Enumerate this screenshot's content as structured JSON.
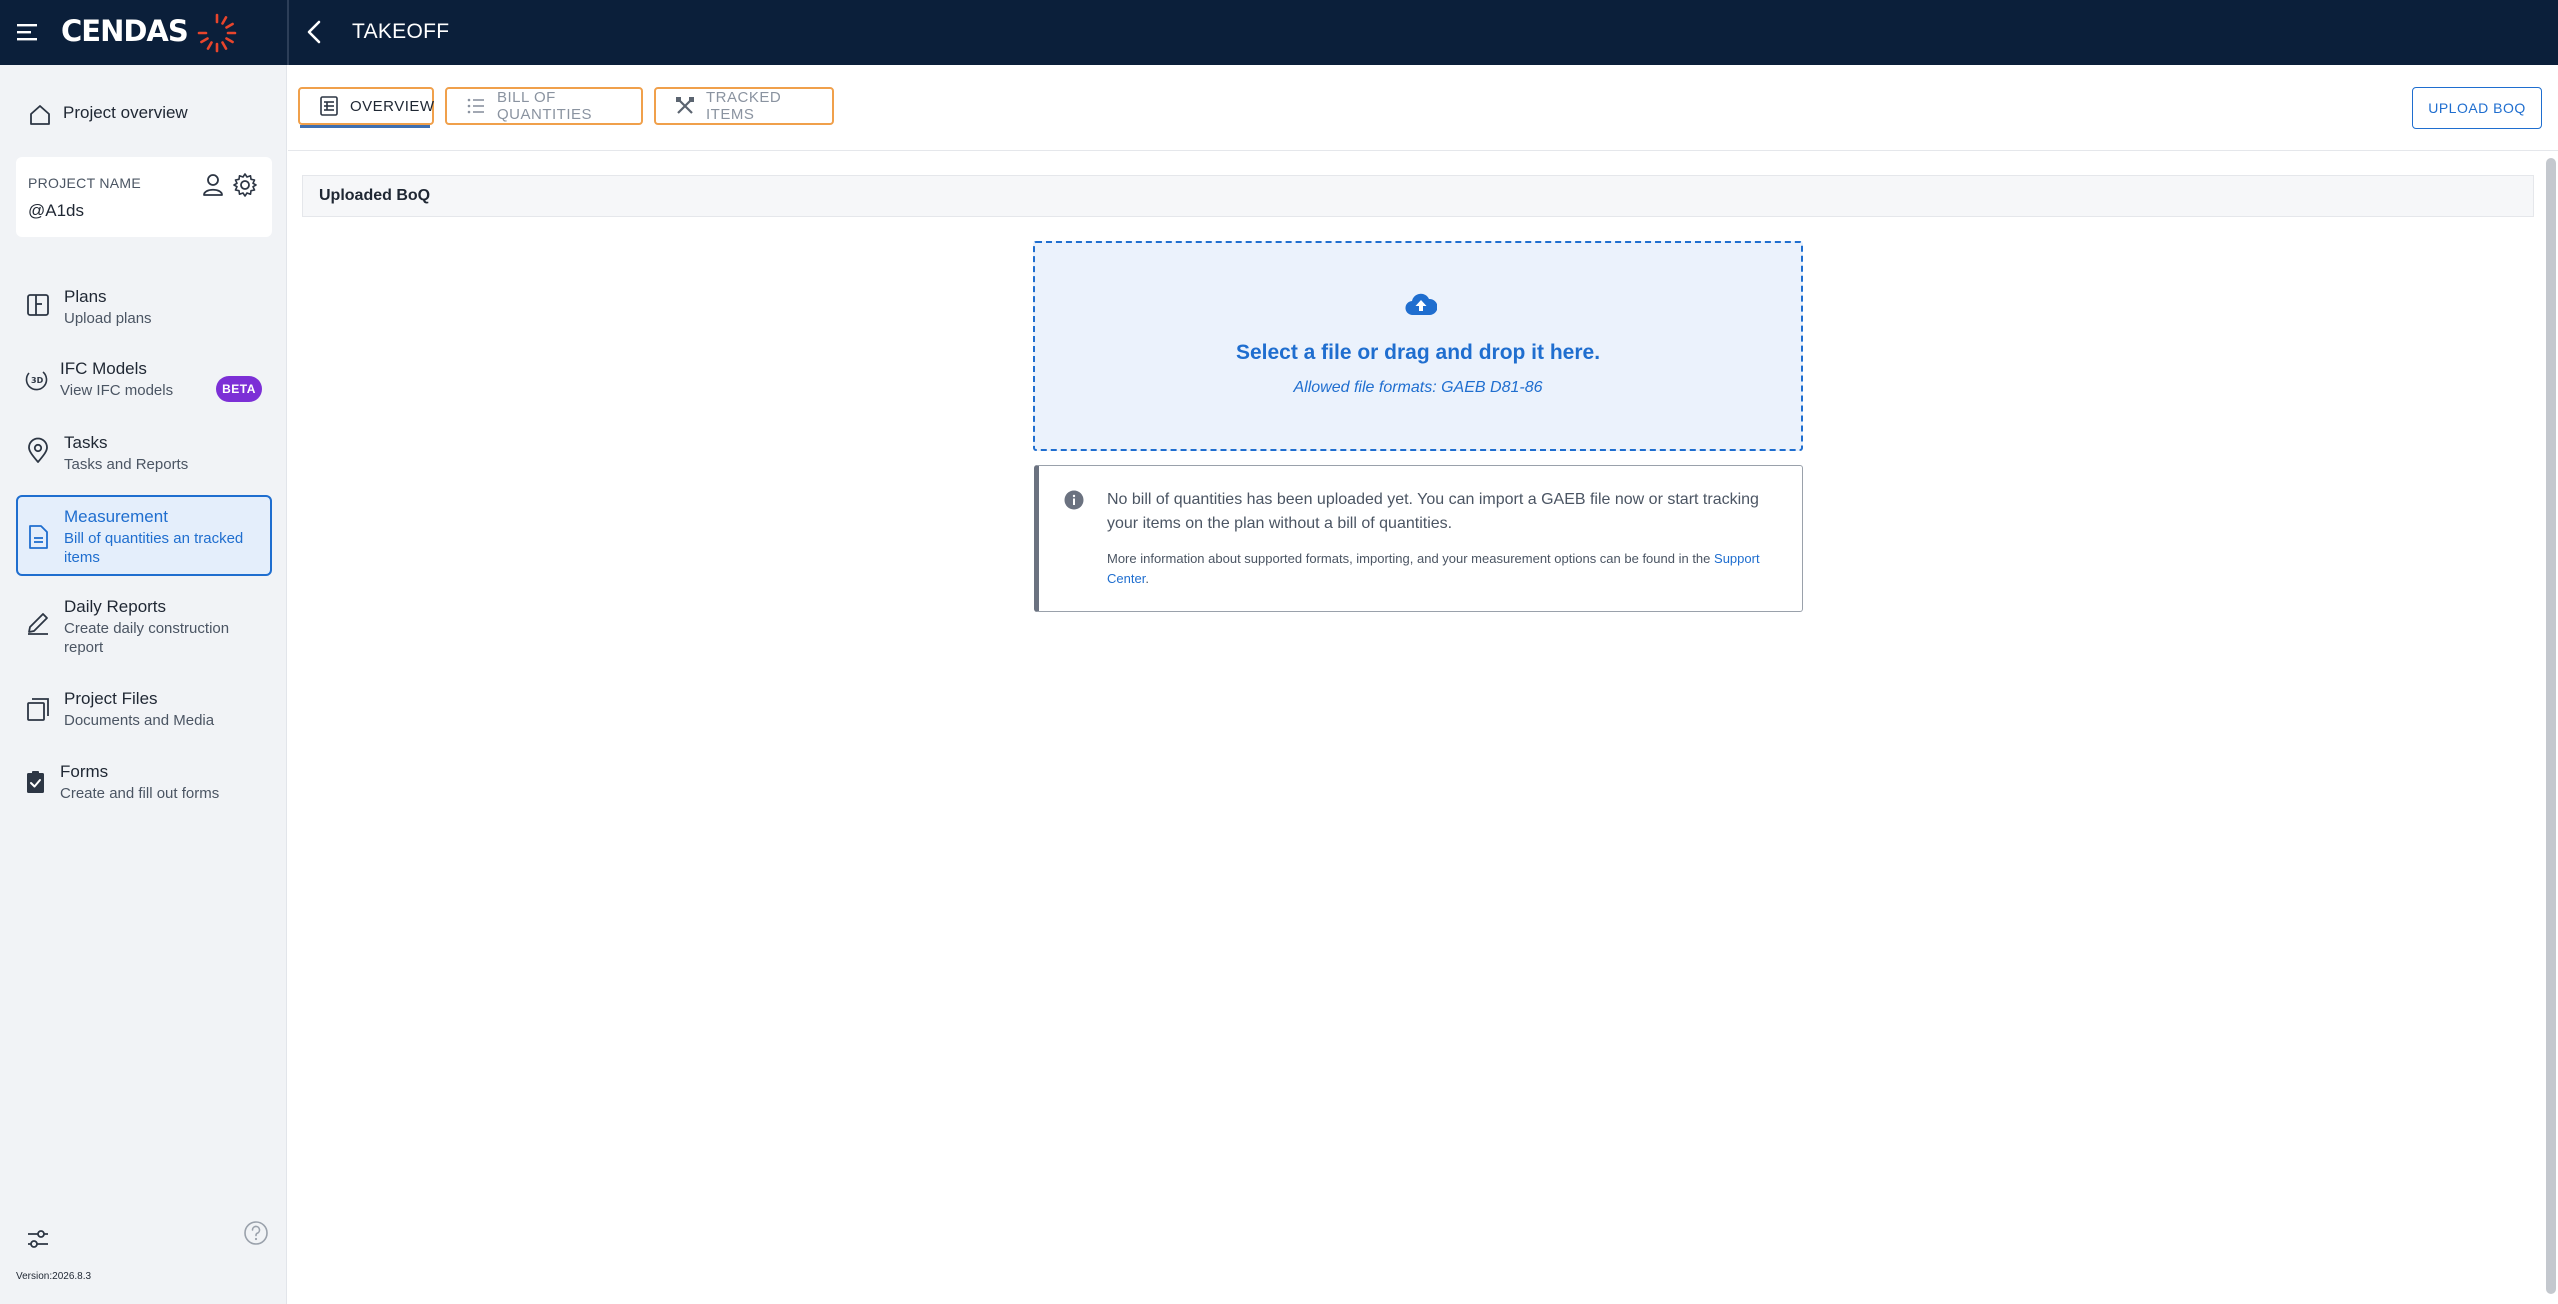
{
  "header": {
    "logo_text": "CENDAS",
    "title": "TAKEOFF",
    "brand_color": "#0b1f3a",
    "logo_accent": "#e8452c"
  },
  "sidebar": {
    "overview_label": "Project overview",
    "project": {
      "label": "PROJECT NAME",
      "value": "@A1ds"
    },
    "items": [
      {
        "title": "Plans",
        "subtitle": "Upload plans",
        "icon": "plans-icon"
      },
      {
        "title": "IFC Models",
        "subtitle": "View IFC models",
        "icon": "3d-icon",
        "badge": "BETA"
      },
      {
        "title": "Tasks",
        "subtitle": "Tasks and Reports",
        "icon": "location-pin-icon"
      },
      {
        "title": "Measurement",
        "subtitle": "Bill of quantities an tracked items",
        "icon": "document-icon",
        "active": true
      },
      {
        "title": "Daily Reports",
        "subtitle": "Create daily construction report",
        "icon": "pencil-icon"
      },
      {
        "title": "Project Files",
        "subtitle": "Documents and Media",
        "icon": "files-icon"
      },
      {
        "title": "Forms",
        "subtitle": "Create and fill out forms",
        "icon": "checklist-icon"
      }
    ],
    "version": "Version:2026.8.3",
    "accent_color": "#1f6ecf"
  },
  "tabs": [
    {
      "label": "OVERVIEW",
      "icon": "overview-icon",
      "active": true
    },
    {
      "label": "BILL OF QUANTITIES",
      "icon": "list-icon"
    },
    {
      "label": "TRACKED ITEMS",
      "icon": "ruler-pencil-icon"
    }
  ],
  "toolbar": {
    "upload_label": "UPLOAD BOQ"
  },
  "section": {
    "title": "Uploaded BoQ"
  },
  "dropzone": {
    "title": "Select a file or drag and drop it here.",
    "subtitle": "Allowed file formats: GAEB D81-86"
  },
  "info": {
    "main": "No bill of quantities has been uploaded yet. You can import a GAEB file now or start tracking your items on the plan without a bill of quantities.",
    "more_prefix": "More information about supported formats, importing, and your measurement options can be found in the",
    "link": "Support Center",
    "more_suffix": "."
  }
}
